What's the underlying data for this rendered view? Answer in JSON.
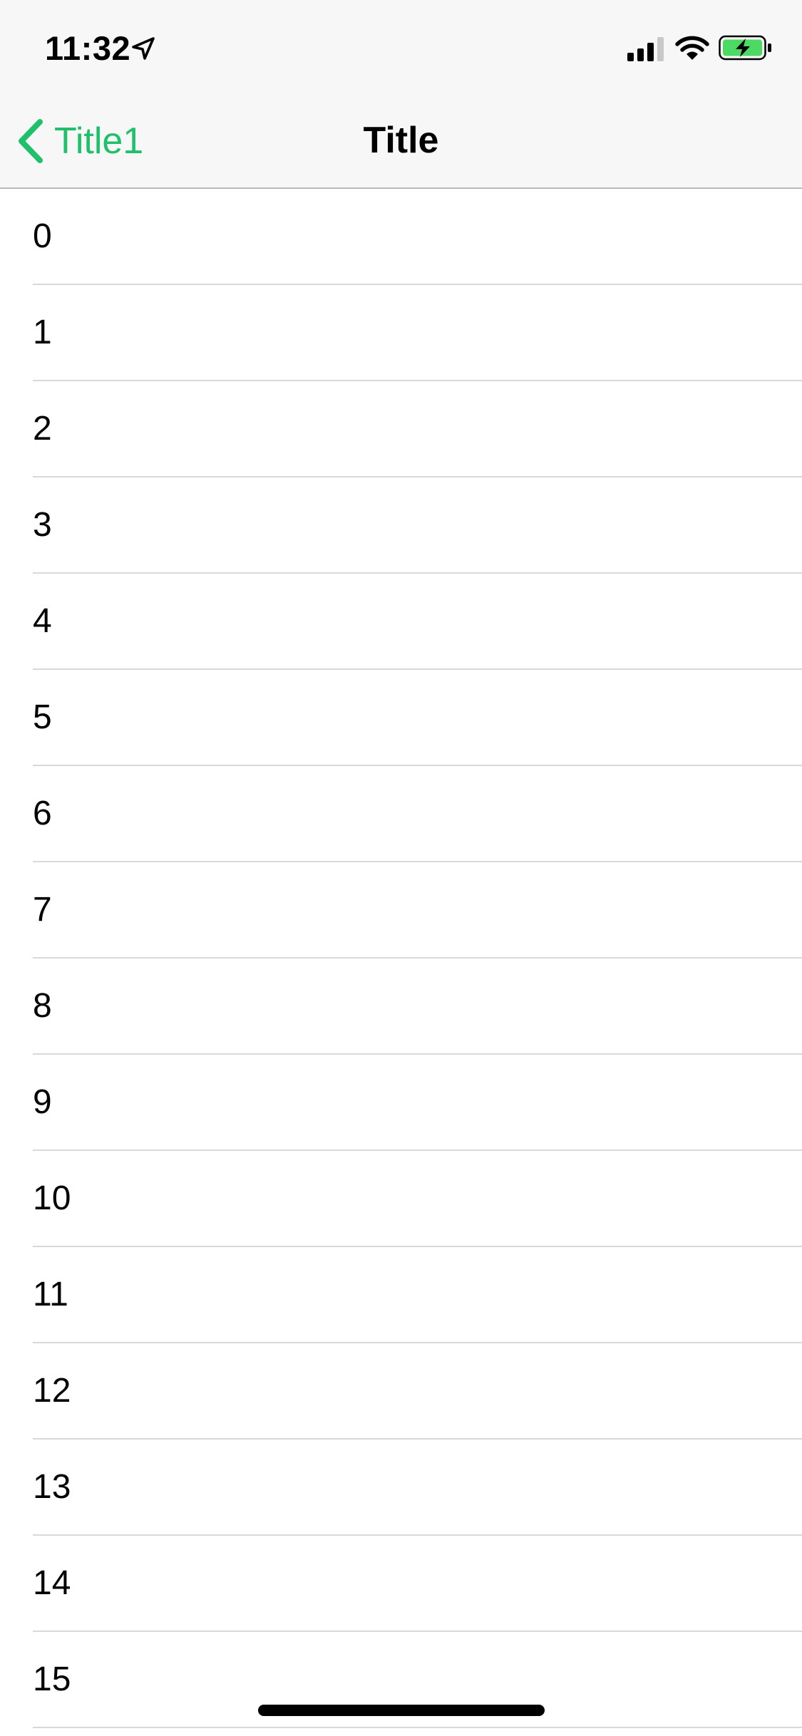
{
  "status_bar": {
    "time": "11:32",
    "icons": [
      "location-arrow-icon",
      "cellular-signal-icon",
      "wifi-icon",
      "battery-charging-icon"
    ],
    "battery_color": "#4cd964"
  },
  "nav": {
    "back_label": "Title1",
    "title": "Title",
    "accent_color": "#1ec06a"
  },
  "list": {
    "items": [
      {
        "label": "0"
      },
      {
        "label": "1"
      },
      {
        "label": "2"
      },
      {
        "label": "3"
      },
      {
        "label": "4"
      },
      {
        "label": "5"
      },
      {
        "label": "6"
      },
      {
        "label": "7"
      },
      {
        "label": "8"
      },
      {
        "label": "9"
      },
      {
        "label": "10"
      },
      {
        "label": "11"
      },
      {
        "label": "12"
      },
      {
        "label": "13"
      },
      {
        "label": "14"
      },
      {
        "label": "15"
      }
    ]
  }
}
